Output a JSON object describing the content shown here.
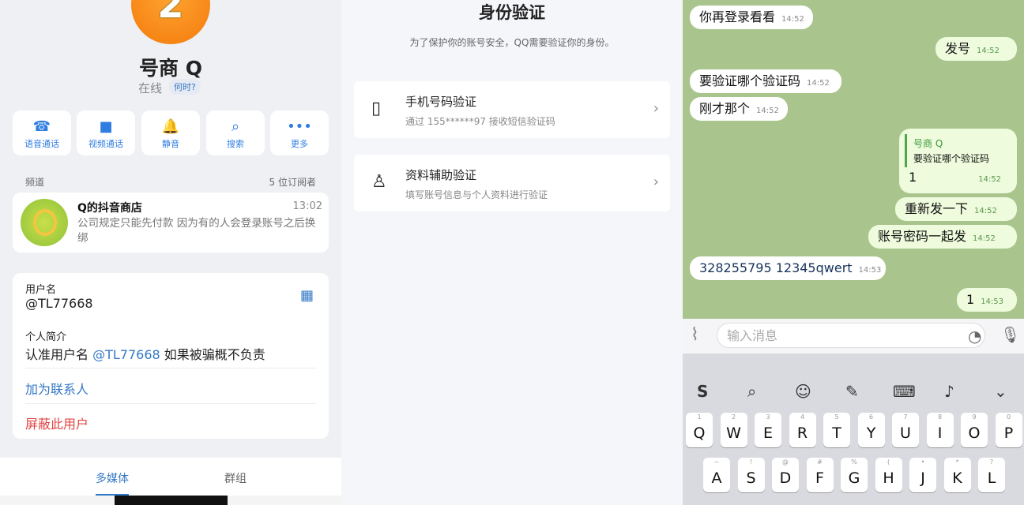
{
  "left": {
    "avatar_text": "2",
    "name": "号商 Q",
    "status": "在线",
    "when_badge": "何时?",
    "actions": [
      {
        "label": "语音通话",
        "icon": "phone-icon",
        "glyph": "☎"
      },
      {
        "label": "视频通话",
        "icon": "video-icon",
        "glyph": "■"
      },
      {
        "label": "静音",
        "icon": "bell-icon",
        "glyph": "🔔"
      },
      {
        "label": "搜索",
        "icon": "search-icon",
        "glyph": "⌕"
      },
      {
        "label": "更多",
        "icon": "more-icon",
        "glyph": "•••"
      }
    ],
    "channel_label": "频道",
    "subscribers": "5 位订阅者",
    "channel": {
      "title": "Q的抖音商店",
      "time": "13:02",
      "message": "公司规定只能先付款 因为有的人会登录账号之后换绑"
    },
    "username_label": "用户名",
    "username": "@TL77668",
    "bio_label": "个人简介",
    "bio_prefix": "认准用户名 ",
    "bio_link": "@TL77668",
    "bio_suffix": " 如果被骗概不负责",
    "add_contact": "加为联系人",
    "block_user": "屏蔽此用户",
    "tabs": [
      "多媒体",
      "群组"
    ]
  },
  "middle": {
    "title": "身份验证",
    "subtitle": "为了保护你的账号安全，QQ需要验证你的身份。",
    "options": [
      {
        "title": "手机号码验证",
        "sub": "通过 155******97 接收短信验证码",
        "icon": "phone-device-icon"
      },
      {
        "title": "资料辅助验证",
        "sub": "填写账号信息与个人资料进行验证",
        "icon": "person-key-icon"
      }
    ]
  },
  "right": {
    "messages": [
      {
        "text": "你再登录看看",
        "time": "14:52",
        "dir": "in"
      },
      {
        "text": "发号",
        "time": "14:52",
        "dir": "out"
      },
      {
        "text": "要验证哪个验证码",
        "time": "14:52",
        "dir": "in"
      },
      {
        "text": "刚才那个",
        "time": "14:52",
        "dir": "in"
      },
      {
        "text": "1",
        "time": "14:52",
        "dir": "out"
      },
      {
        "text": "重新发一下",
        "time": "14:52",
        "dir": "out"
      },
      {
        "text": "账号密码一起发",
        "time": "14:52",
        "dir": "out"
      },
      {
        "text": "328255795  12345qwert",
        "time": "14:53",
        "dir": "in"
      },
      {
        "text": "1",
        "time": "14:53",
        "dir": "out"
      }
    ],
    "quote_name": "号商 Q",
    "quote_text": "要验证哪个验证码",
    "input_placeholder": "输入消息",
    "keyboard": {
      "row1": [
        "Q",
        "W",
        "E",
        "R",
        "T",
        "Y",
        "U",
        "I",
        "O",
        "P"
      ],
      "row1_hints": [
        "1",
        "2",
        "3",
        "4",
        "5",
        "6",
        "7",
        "8",
        "9",
        "0"
      ],
      "row2": [
        "A",
        "S",
        "D",
        "F",
        "G",
        "H",
        "J",
        "K",
        "L"
      ],
      "row2_hints": [
        "~",
        "!",
        "@",
        "#",
        "%",
        "(",
        "•",
        "*",
        "?"
      ]
    }
  }
}
